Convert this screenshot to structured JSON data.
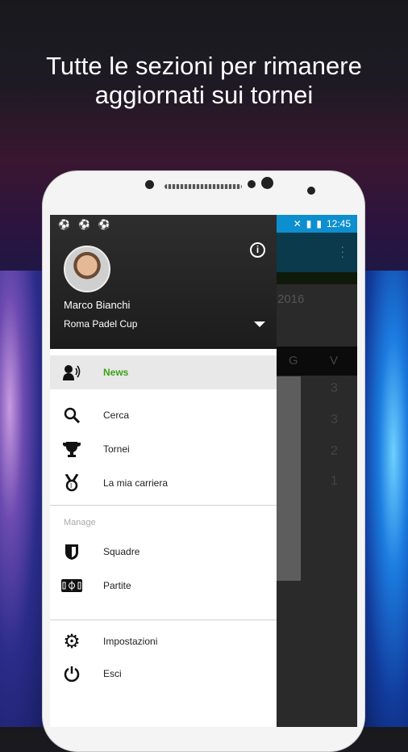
{
  "headline": {
    "line1": "Tutte le sezioni per rimanere",
    "line2": "aggiornati sui tornei"
  },
  "status_bar": {
    "time": "12:45"
  },
  "background_app": {
    "year": "2016",
    "columns": [
      "G",
      "V"
    ],
    "v_values": [
      "3",
      "3",
      "2",
      "1"
    ]
  },
  "drawer": {
    "user_name": "Marco Bianchi",
    "tournament": "Roma Padel Cup",
    "items": [
      {
        "label": "News",
        "icon": "news-speaker-icon",
        "active": true
      },
      {
        "label": "Cerca",
        "icon": "search-icon"
      },
      {
        "label": "Tornei",
        "icon": "trophy-icon"
      },
      {
        "label": "La mia carriera",
        "icon": "medal-icon"
      }
    ],
    "manage_header": "Manage",
    "manage_items": [
      {
        "label": "Squadre",
        "icon": "shield-icon"
      },
      {
        "label": "Partite",
        "icon": "field-icon"
      }
    ],
    "footer_items": [
      {
        "label": "Impostazioni",
        "icon": "gear-icon"
      },
      {
        "label": "Esci",
        "icon": "power-icon"
      }
    ]
  },
  "colors": {
    "active": "#3aa317",
    "status_bar": "#0d8fcf"
  }
}
